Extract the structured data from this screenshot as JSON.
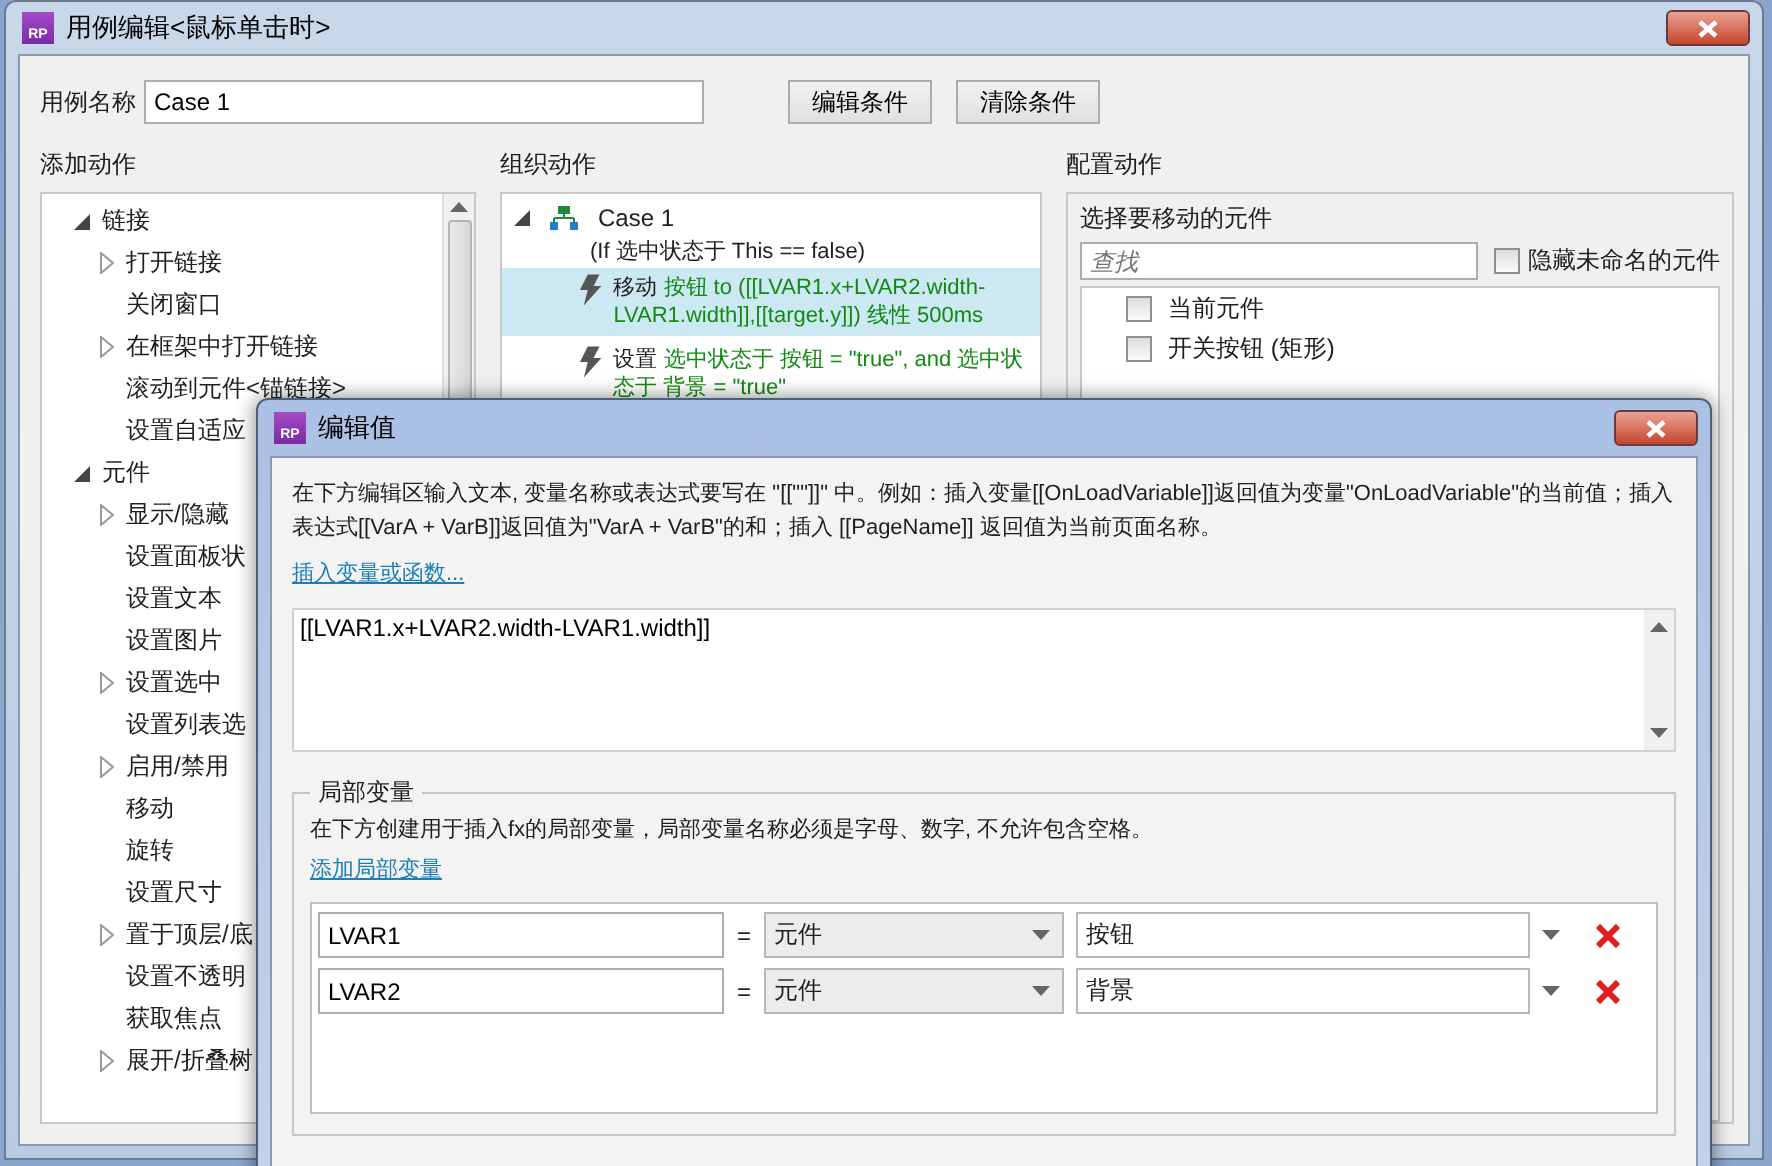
{
  "window": {
    "badge": "RP",
    "title": "用例编辑<鼠标单击时>"
  },
  "case_name": {
    "label": "用例名称",
    "value": "Case 1"
  },
  "buttons": [
    "编辑条件",
    "清除条件"
  ],
  "add_actions": {
    "heading": "添加动作",
    "groups": [
      {
        "label": "链接",
        "expanded": true,
        "children": [
          {
            "label": "打开链接",
            "kind": "folder",
            "expanded": false
          },
          {
            "label": "关闭窗口",
            "kind": "action"
          },
          {
            "label": "在框架中打开链接",
            "kind": "folder",
            "expanded": false
          },
          {
            "label": "滚动到元件<锚链接>",
            "kind": "action"
          },
          {
            "label": "设置自适应",
            "kind": "action"
          }
        ]
      },
      {
        "label": "元件",
        "expanded": true,
        "children": [
          {
            "label": "显示/隐藏",
            "kind": "folder",
            "expanded": false
          },
          {
            "label": "设置面板状",
            "kind": "action"
          },
          {
            "label": "设置文本",
            "kind": "action"
          },
          {
            "label": "设置图片",
            "kind": "action"
          },
          {
            "label": "设置选中",
            "kind": "folder",
            "expanded": false
          },
          {
            "label": "设置列表选",
            "kind": "action"
          },
          {
            "label": "启用/禁用",
            "kind": "folder",
            "expanded": false
          },
          {
            "label": "移动",
            "kind": "action"
          },
          {
            "label": "旋转",
            "kind": "action"
          },
          {
            "label": "设置尺寸",
            "kind": "action"
          },
          {
            "label": "置于顶层/底",
            "kind": "folder",
            "expanded": false
          },
          {
            "label": "设置不透明",
            "kind": "action"
          },
          {
            "label": "获取焦点",
            "kind": "action"
          },
          {
            "label": "展开/折叠树",
            "kind": "folder",
            "expanded": false
          }
        ]
      }
    ]
  },
  "organize": {
    "heading": "组织动作",
    "case": {
      "name": "Case 1",
      "condition": "(If 选中状态于 This == false)",
      "expanded": true
    },
    "actions": [
      {
        "verb": "移动",
        "detail": "按钮 to ([[LVAR1.x+LVAR2.width-LVAR1.width]],[[target.y]]) 线性 500ms",
        "selected": true
      },
      {
        "verb": "设置",
        "detail": "选中状态于 按钮 = \"true\", and 选中状态于 背景 = \"true\"",
        "selected": false
      }
    ]
  },
  "configure": {
    "heading": "配置动作",
    "title": "选择要移动的元件",
    "search": {
      "placeholder": "查找"
    },
    "hide_unnamed": {
      "label": "隐藏未命名的元件",
      "checked": false
    },
    "widgets": [
      {
        "label": "当前元件",
        "checked": false
      },
      {
        "label": "开关按钮 (矩形)",
        "checked": false
      }
    ]
  },
  "dialog": {
    "badge": "RP",
    "title": "编辑值",
    "description": "在下方编辑区输入文本, 变量名称或表达式要写在 \"[[\"\"]]\" 中。例如：插入变量[[OnLoadVariable]]返回值为变量\"OnLoadVariable\"的当前值；插入表达式[[VarA + VarB]]返回值为\"VarA + VarB\"的和；插入 [[PageName]] 返回值为当前页面名称。",
    "insert_link": "插入变量或函数...",
    "expression": "[[LVAR1.x+LVAR2.width-LVAR1.width]]",
    "local_vars": {
      "legend": "局部变量",
      "description": "在下方创建用于插入fx的局部变量，局部变量名称必须是字母、数字, 不允许包含空格。",
      "add_link": "添加局部变量",
      "rows": [
        {
          "name": "LVAR1",
          "equals": "=",
          "type": "元件",
          "target": "按钮"
        },
        {
          "name": "LVAR2",
          "equals": "=",
          "type": "元件",
          "target": "背景"
        }
      ]
    }
  }
}
